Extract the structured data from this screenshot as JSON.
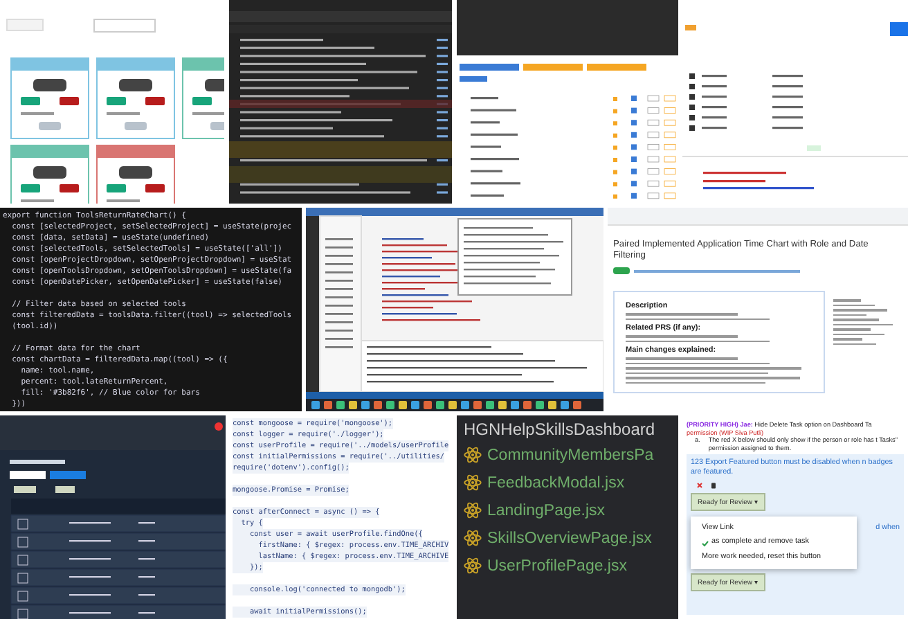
{
  "tiles": [
    {
      "kind": "timers"
    },
    {
      "kind": "devtools"
    },
    {
      "kind": "browser-table"
    },
    {
      "kind": "api-client"
    },
    {
      "kind": "code-dark",
      "blocks": [
        [
          "export function ToolsReturnRateChart() {",
          "  const [selectedProject, setSelectedProject] = useState(projec",
          "  const [data, setData] = useState(undefined)",
          "  const [selectedTools, setSelectedTools] = useState(['all'])",
          "  const [openProjectDropdown, setOpenProjectDropdown] = useStat",
          "  const [openToolsDropdown, setOpenToolsDropdown] = useState(fa",
          "  const [openDatePicker, setOpenDatePicker] = useState(false)"
        ],
        [
          "  // Filter data based on selected tools",
          "  const filteredData = toolsData.filter((tool) => selectedTools",
          "  (tool.id))"
        ],
        [
          "  // Format data for the chart",
          "  const chartData = filteredData.map((tool) => ({",
          "    name: tool.name,",
          "    percent: tool.lateReturnPercent,",
          "    fill: '#3b82f6', // Blue color for bars",
          "  }))"
        ]
      ]
    },
    {
      "kind": "ide"
    },
    {
      "kind": "pull-request",
      "title": "Paired Implemented Application Time Chart with Role and Date Filtering",
      "headings": [
        "Description",
        "Related PRS (if any):",
        "Main changes explained:"
      ]
    },
    {
      "kind": "dark-table"
    },
    {
      "kind": "code-light",
      "blocks": [
        [
          "const mongoose = require('mongoose');",
          "const logger = require('./logger');",
          "const userProfile = require('../models/userProfile",
          "const initialPermissions = require('../utilities/",
          "require('dotenv').config();"
        ],
        [
          "mongoose.Promise = Promise;"
        ],
        [
          "const afterConnect = async () => {",
          "  try {",
          "    const user = await userProfile.findOne({",
          "      firstName: { $regex: process.env.TIME_ARCHIV",
          "      lastName: { $regex: process.env.TIME_ARCHIVE",
          "    });"
        ],
        [
          "    console.log('connected to mongodb');"
        ],
        [
          "    await initialPermissions();"
        ]
      ]
    },
    {
      "kind": "file-list",
      "folder": "HGNHelpSkillsDashboard",
      "files": [
        "CommunityMembersPa",
        "FeedbackModal.jsx",
        "LandingPage.jsx",
        "SkillsOverviewPage.jsx",
        "UserProfilePage.jsx"
      ]
    },
    {
      "kind": "task-doc",
      "priority": "(PRIORITY HIGH) Jae:",
      "task": "Hide Delete Task option on Dashboard Ta",
      "owner": "permission (WIP Siva Putli)",
      "note_marker": "a.",
      "note": "The red X below should only show if the person or role has t Tasks\" permission assigned to them.",
      "link": "123 Export Featured button must be disabled when n badges are featured.",
      "button": "Ready for Review ▾",
      "menu": [
        {
          "label": "View Link",
          "checked": false
        },
        {
          "label": "as complete and remove task",
          "checked": true
        },
        {
          "label": "More work needed, reset this button",
          "checked": false
        }
      ],
      "behind_text": "d when",
      "behind_button": "Ready for Review ▾"
    }
  ]
}
